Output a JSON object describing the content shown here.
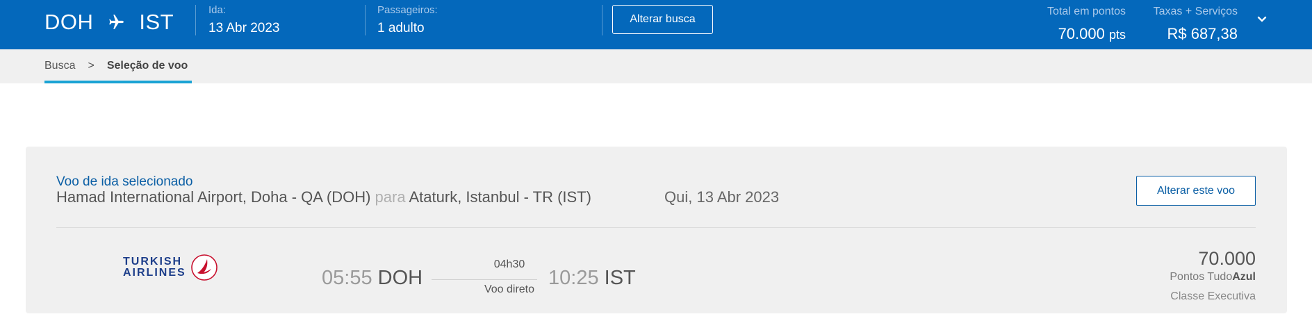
{
  "header": {
    "origin": "DOH",
    "destination": "IST",
    "ida_label": "Ida:",
    "ida_value": "13 Abr 2023",
    "passengers_label": "Passageiros:",
    "passengers_value": "1 adulto",
    "alter_search_label": "Alterar busca",
    "total_points_label": "Total em pontos",
    "total_points_value": "70.000",
    "total_points_unit": "pts",
    "taxes_label": "Taxas + Serviços",
    "taxes_value": "R$ 687,38",
    "icons": {
      "plane": "plane-icon",
      "expand": "chevron-down-icon"
    }
  },
  "breadcrumb": {
    "items": [
      {
        "label": "Busca"
      },
      {
        "label": "Seleção de voo"
      }
    ],
    "separator": ">"
  },
  "flight_card": {
    "title": "Voo de ida selecionado",
    "from_airport": "Hamad International Airport, Doha - QA (DOH)",
    "connector": "para",
    "to_airport": "Ataturk, Istanbul - TR (IST)",
    "date": "Qui, 13 Abr 2023",
    "alter_flight_label": "Alterar este voo",
    "airline_line1": "TURKISH",
    "airline_line2": "AIRLINES",
    "depart_time": "05:55",
    "depart_code": "DOH",
    "duration": "04h30",
    "stops": "Voo direto",
    "arrive_time": "10:25",
    "arrive_code": "IST",
    "points": "70.000",
    "points_label_prefix": "Pontos Tudo",
    "points_label_brand": "Azul",
    "cabin": "Classe Executiva"
  },
  "colors": {
    "brand_blue": "#0468bb",
    "accent_cyan": "#1aa3d4",
    "airline_red": "#c8102e",
    "airline_navy": "#1d3e8a"
  }
}
